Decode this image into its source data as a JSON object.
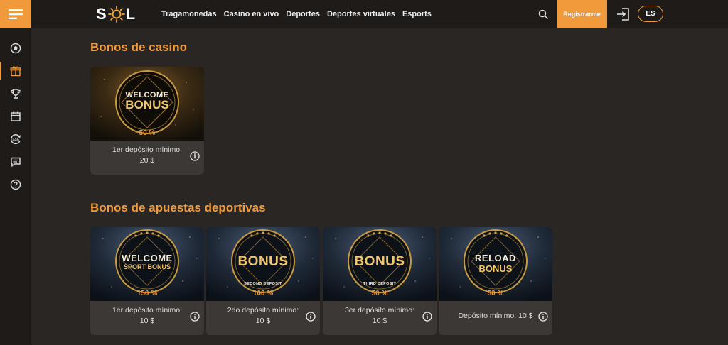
{
  "header": {
    "logo_letters": [
      "S",
      "L"
    ],
    "nav": [
      "Tragamonedas",
      "Casino en vivo",
      "Deportes",
      "Deportes virtuales",
      "Esports"
    ],
    "register_label": "Registrarme",
    "lang_label": "ES"
  },
  "sidebar": {
    "items": [
      "soccer-ball-icon",
      "gift-icon",
      "trophy-icon",
      "calendar-icon",
      "24h-icon",
      "chat-icon",
      "help-icon"
    ],
    "active_index": 1
  },
  "casino": {
    "title": "Bonos de casino",
    "cards": [
      {
        "badge_line1": "WELCOME",
        "badge_line2": "BONUS",
        "badge_sub": "",
        "percent": "50 %",
        "desc_line1": "1er depósito mínimo:",
        "desc_line2": "20 $"
      }
    ]
  },
  "sports": {
    "title": "Bonos de apuestas deportivas",
    "cards": [
      {
        "badge_line1": "WELCOME",
        "badge_line2": "SPORT BONUS",
        "badge_sub": "",
        "percent": "150 %",
        "desc_line1": "1er depósito mínimo:",
        "desc_line2": "10 $"
      },
      {
        "badge_line1": "BONUS",
        "badge_line2": "",
        "badge_sub": "SECOND DEPOSIT",
        "percent": "100 %",
        "desc_line1": "2do depósito mínimo:",
        "desc_line2": "10 $"
      },
      {
        "badge_line1": "BONUS",
        "badge_line2": "",
        "badge_sub": "THIRD DEPOSIT",
        "percent": "50 %",
        "desc_line1": "3er depósito mínimo:",
        "desc_line2": "10 $"
      },
      {
        "badge_line1": "RELOAD",
        "badge_line2": "BONUS",
        "badge_sub": "",
        "percent": "50 %",
        "desc_line1": "Depósito mínimo: 10 $",
        "desc_line2": ""
      }
    ]
  },
  "colors": {
    "accent": "#f09a3b",
    "background": "#2a2623",
    "bar": "#1e1b19",
    "card": "#3c3835",
    "gold": "#d9a441"
  }
}
